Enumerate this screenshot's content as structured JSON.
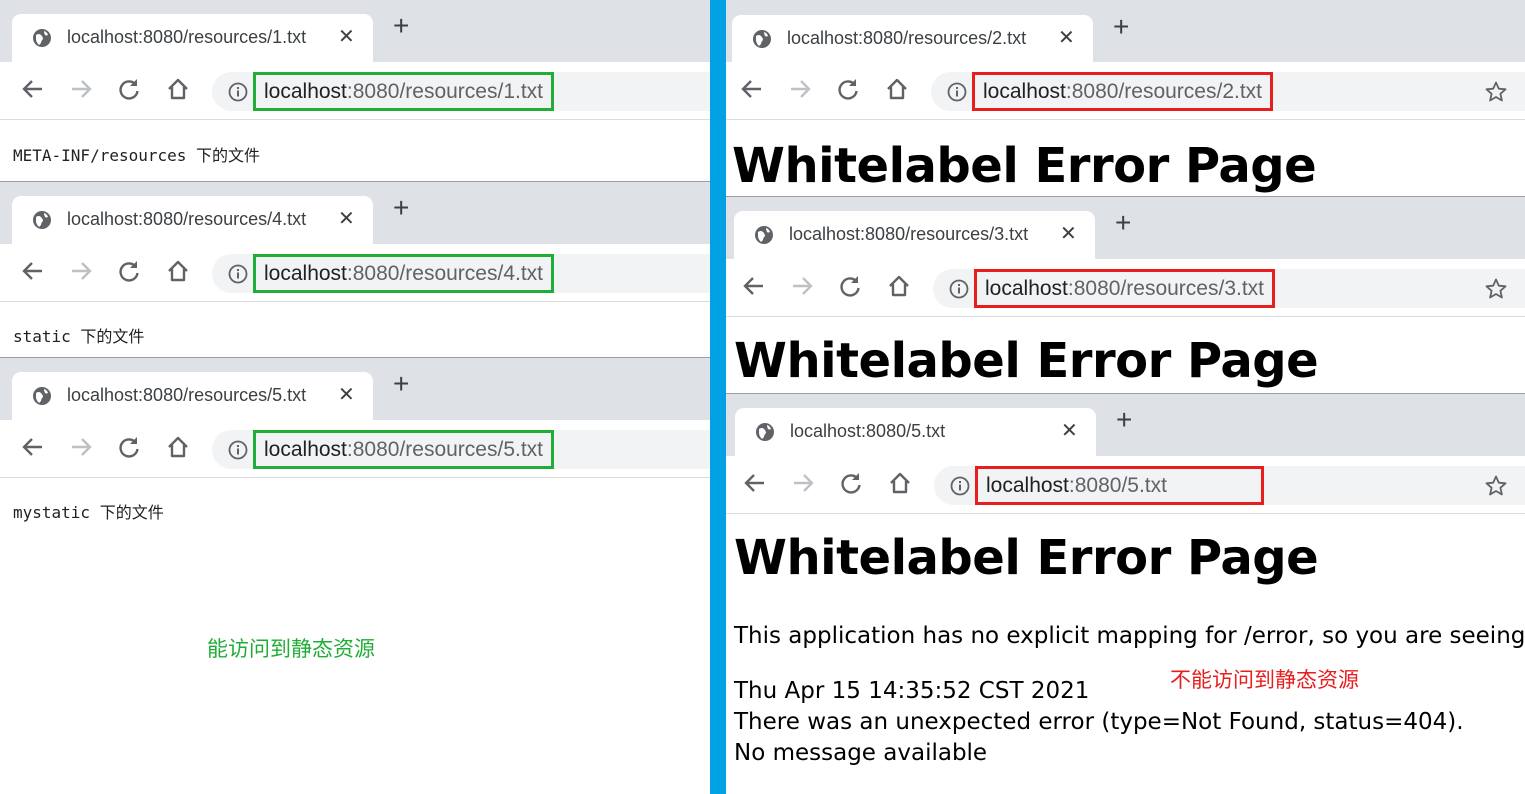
{
  "left_panel": {
    "note": "能访问到静态资源",
    "note_color": "#22ad38",
    "windows": [
      {
        "tab_title": "localhost:8080/resources/1.txt",
        "url_host": "localhost",
        "url_rest": ":8080/resources/1.txt",
        "content": "META-INF/resources 下的文件"
      },
      {
        "tab_title": "localhost:8080/resources/4.txt",
        "url_host": "localhost",
        "url_rest": ":8080/resources/4.txt",
        "content": "static 下的文件"
      },
      {
        "tab_title": "localhost:8080/resources/5.txt",
        "url_host": "localhost",
        "url_rest": ":8080/resources/5.txt",
        "content": "mystatic 下的文件"
      }
    ]
  },
  "right_panel": {
    "note": "不能访问到静态资源",
    "note_color": "#e81e1e",
    "windows": [
      {
        "tab_title": "localhost:8080/resources/2.txt",
        "url_host": "localhost",
        "url_rest": ":8080/resources/2.txt",
        "heading": "Whitelabel Error Page"
      },
      {
        "tab_title": "localhost:8080/resources/3.txt",
        "url_host": "localhost",
        "url_rest": ":8080/resources/3.txt",
        "heading": "Whitelabel Error Page"
      },
      {
        "tab_title": "localhost:8080/5.txt",
        "url_host": "localhost",
        "url_rest": ":8080/5.txt",
        "heading": "Whitelabel Error Page",
        "message": "This application has no explicit mapping for /error, so you are seeing",
        "timestamp": "Thu Apr 15 14:35:52 CST 2021",
        "error_line": "There was an unexpected error (type=Not Found, status=404).",
        "detail": "No message available"
      }
    ]
  },
  "colors": {
    "ok_border": "#22ad38",
    "error_border": "#e81e1e",
    "divider": "#01a1e4"
  },
  "icons": {
    "tab": "globe-icon",
    "back": "arrow-left-icon",
    "forward": "arrow-right-icon",
    "reload": "reload-icon",
    "home": "home-icon",
    "site_info": "info-icon",
    "bookmark": "star-icon",
    "close": "close-icon",
    "new_tab": "plus-icon"
  }
}
